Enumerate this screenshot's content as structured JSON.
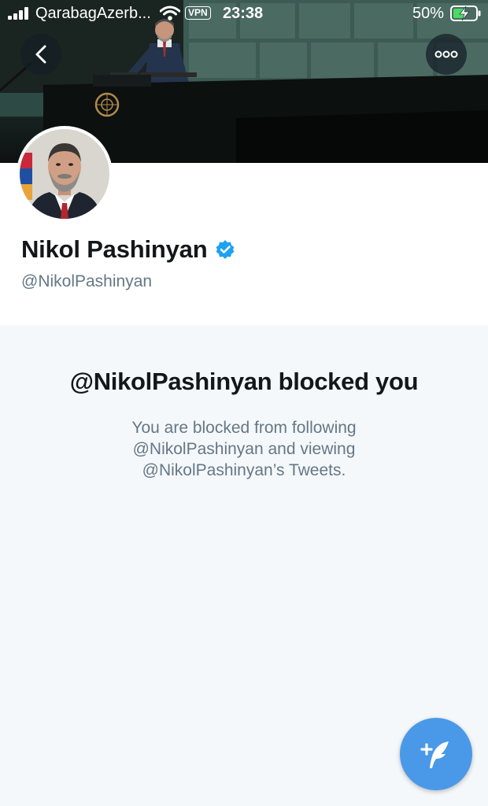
{
  "status_bar": {
    "carrier": "QarabagAzerb...",
    "vpn": "VPN",
    "time": "23:38",
    "battery_percent": "50%",
    "battery_level": 0.5
  },
  "nav": {
    "back_icon": "chevron-left-icon",
    "more_icon": "more-horizontal-icon"
  },
  "profile": {
    "display_name": "Nikol Pashinyan",
    "handle": "@NikolPashinyan",
    "verified": true
  },
  "blocked_notice": {
    "title": "@NikolPashinyan blocked you",
    "line1": "You are blocked from following",
    "line2": "@NikolPashinyan and viewing",
    "line3": "@NikolPashinyan’s Tweets."
  },
  "fab": {
    "icon": "compose-tweet-icon"
  },
  "colors": {
    "accent": "#4a99e9",
    "verified_badge": "#1da1f2",
    "text_primary": "#14171a",
    "text_secondary": "#657786",
    "background": "#f5f8fa"
  }
}
